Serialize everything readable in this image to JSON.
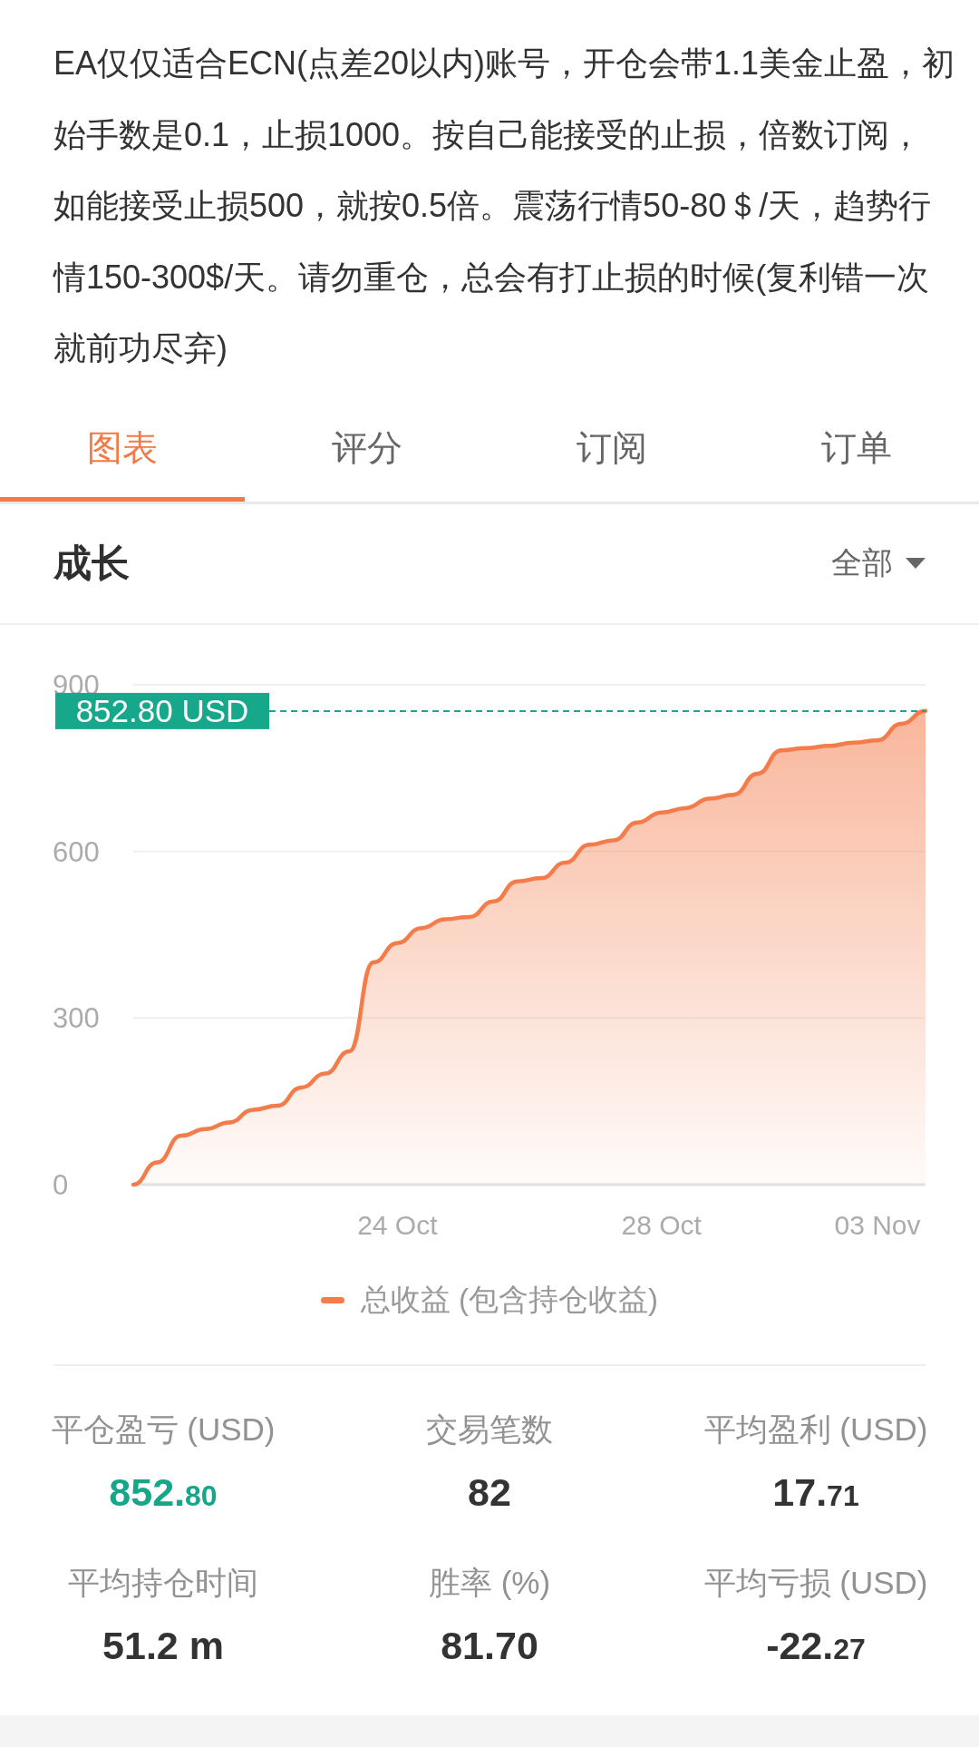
{
  "description": {
    "lines": [
      "EA仅仅适合ECN(点差20以内)账号，开仓会带1.1美金止盈，初",
      "始手数是0.1，止损1000。按自己能接受的止损，倍数订阅，",
      "如能接受止损500，就按0.5倍。震荡行情50-80＄/天，趋势行",
      "情150-300$/天。请勿重仓，总会有打止损的时候(复利错一次",
      "就前功尽弃)"
    ]
  },
  "tabs": [
    {
      "label": "图表",
      "selected": true
    },
    {
      "label": "评分",
      "selected": false
    },
    {
      "label": "订阅",
      "selected": false
    },
    {
      "label": "订单",
      "selected": false
    }
  ],
  "section": {
    "title": "成长",
    "filter": "全部"
  },
  "chart": {
    "chart_data": {
      "type": "area",
      "categories": [
        null,
        null,
        null,
        null,
        null,
        null,
        null,
        null,
        null,
        null,
        null,
        "24 Oct",
        null,
        null,
        null,
        null,
        null,
        null,
        null,
        null,
        null,
        null,
        "28 Oct",
        null,
        null,
        null,
        null,
        null,
        null,
        null,
        null,
        "03 Nov",
        null,
        null
      ],
      "ylim": [
        0,
        900
      ],
      "yticks": [
        0,
        300,
        600,
        900
      ],
      "series": [
        {
          "name": "总收益 (包含持仓收益)",
          "color": "#f47b4a",
          "values": [
            0,
            40,
            88,
            100,
            112,
            135,
            142,
            175,
            200,
            240,
            400,
            435,
            462,
            478,
            482,
            510,
            546,
            552,
            580,
            612,
            620,
            652,
            670,
            678,
            695,
            702,
            740,
            782,
            786,
            790,
            796,
            800,
            830,
            853
          ]
        }
      ],
      "ref_lines": [
        {
          "axis": "y",
          "value": 852.8,
          "label": "852.80 USD"
        }
      ]
    }
  },
  "stats": [
    {
      "label": "平仓盈亏 (USD)",
      "value": "852.",
      "fraction": "80",
      "color": "#17a68a"
    },
    {
      "label": "交易笔数",
      "value": "82",
      "color": "#333333"
    },
    {
      "label": "平均盈利 (USD)",
      "value": "17.",
      "fraction": "71",
      "color": "#333333"
    },
    {
      "label": "平均持仓时间",
      "value": "51.2 m",
      "color": "#333333"
    },
    {
      "label": "胜率 (%)",
      "value": "81.70",
      "color": "#333333"
    },
    {
      "label": "平均亏损 (USD)",
      "value": "-22.",
      "fraction": "27",
      "color": "#333333"
    }
  ]
}
